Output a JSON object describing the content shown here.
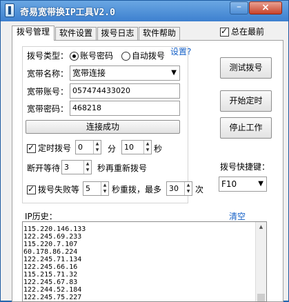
{
  "window": {
    "title": "奇易宽带换IP工具V2.0",
    "min_glyph": "–",
    "close_glyph": "×"
  },
  "tabs": [
    {
      "label": "拨号管理",
      "active": true
    },
    {
      "label": "软件设置"
    },
    {
      "label": "拨号日志"
    },
    {
      "label": "软件帮助"
    }
  ],
  "always_on_top": {
    "label": "总在最前",
    "checked": true
  },
  "dial_type": {
    "label": "拨号类型：",
    "option_password": "账号密码",
    "option_auto": "自动拨号",
    "settings_link": "设置?"
  },
  "broadband": {
    "name_label": "宽带名称：",
    "name_value": "宽带连接",
    "account_label": "宽带账号：",
    "account_value": "057474433020",
    "password_label": "宽带密码：",
    "password_value": "468218"
  },
  "connect_status": "连接成功",
  "timer": {
    "label": "定时拨号",
    "minutes": "0",
    "min_unit": "分",
    "seconds": "10",
    "sec_unit": "秒"
  },
  "reconnect": {
    "prefix": "断开等待",
    "value": "3",
    "suffix": "秒再重新拨号"
  },
  "retry": {
    "label": "拨号失败等",
    "wait": "5",
    "mid": "秒重拨，最多",
    "max": "30",
    "unit": "次"
  },
  "buttons": {
    "test_dial": "测试拨号",
    "start_timer": "开始定时",
    "stop": "停止工作"
  },
  "hotkey": {
    "label": "拨号快捷键：",
    "value": "F10"
  },
  "history": {
    "label": "IP历史：",
    "clear": "清空",
    "entries": [
      "115.220.146.133",
      "122.245.69.233",
      "115.220.7.107",
      "60.178.86.224",
      "122.245.71.134",
      "122.245.66.16",
      "115.215.71.32",
      "122.245.67.83",
      "122.244.52.184",
      "122.245.75.227"
    ]
  }
}
